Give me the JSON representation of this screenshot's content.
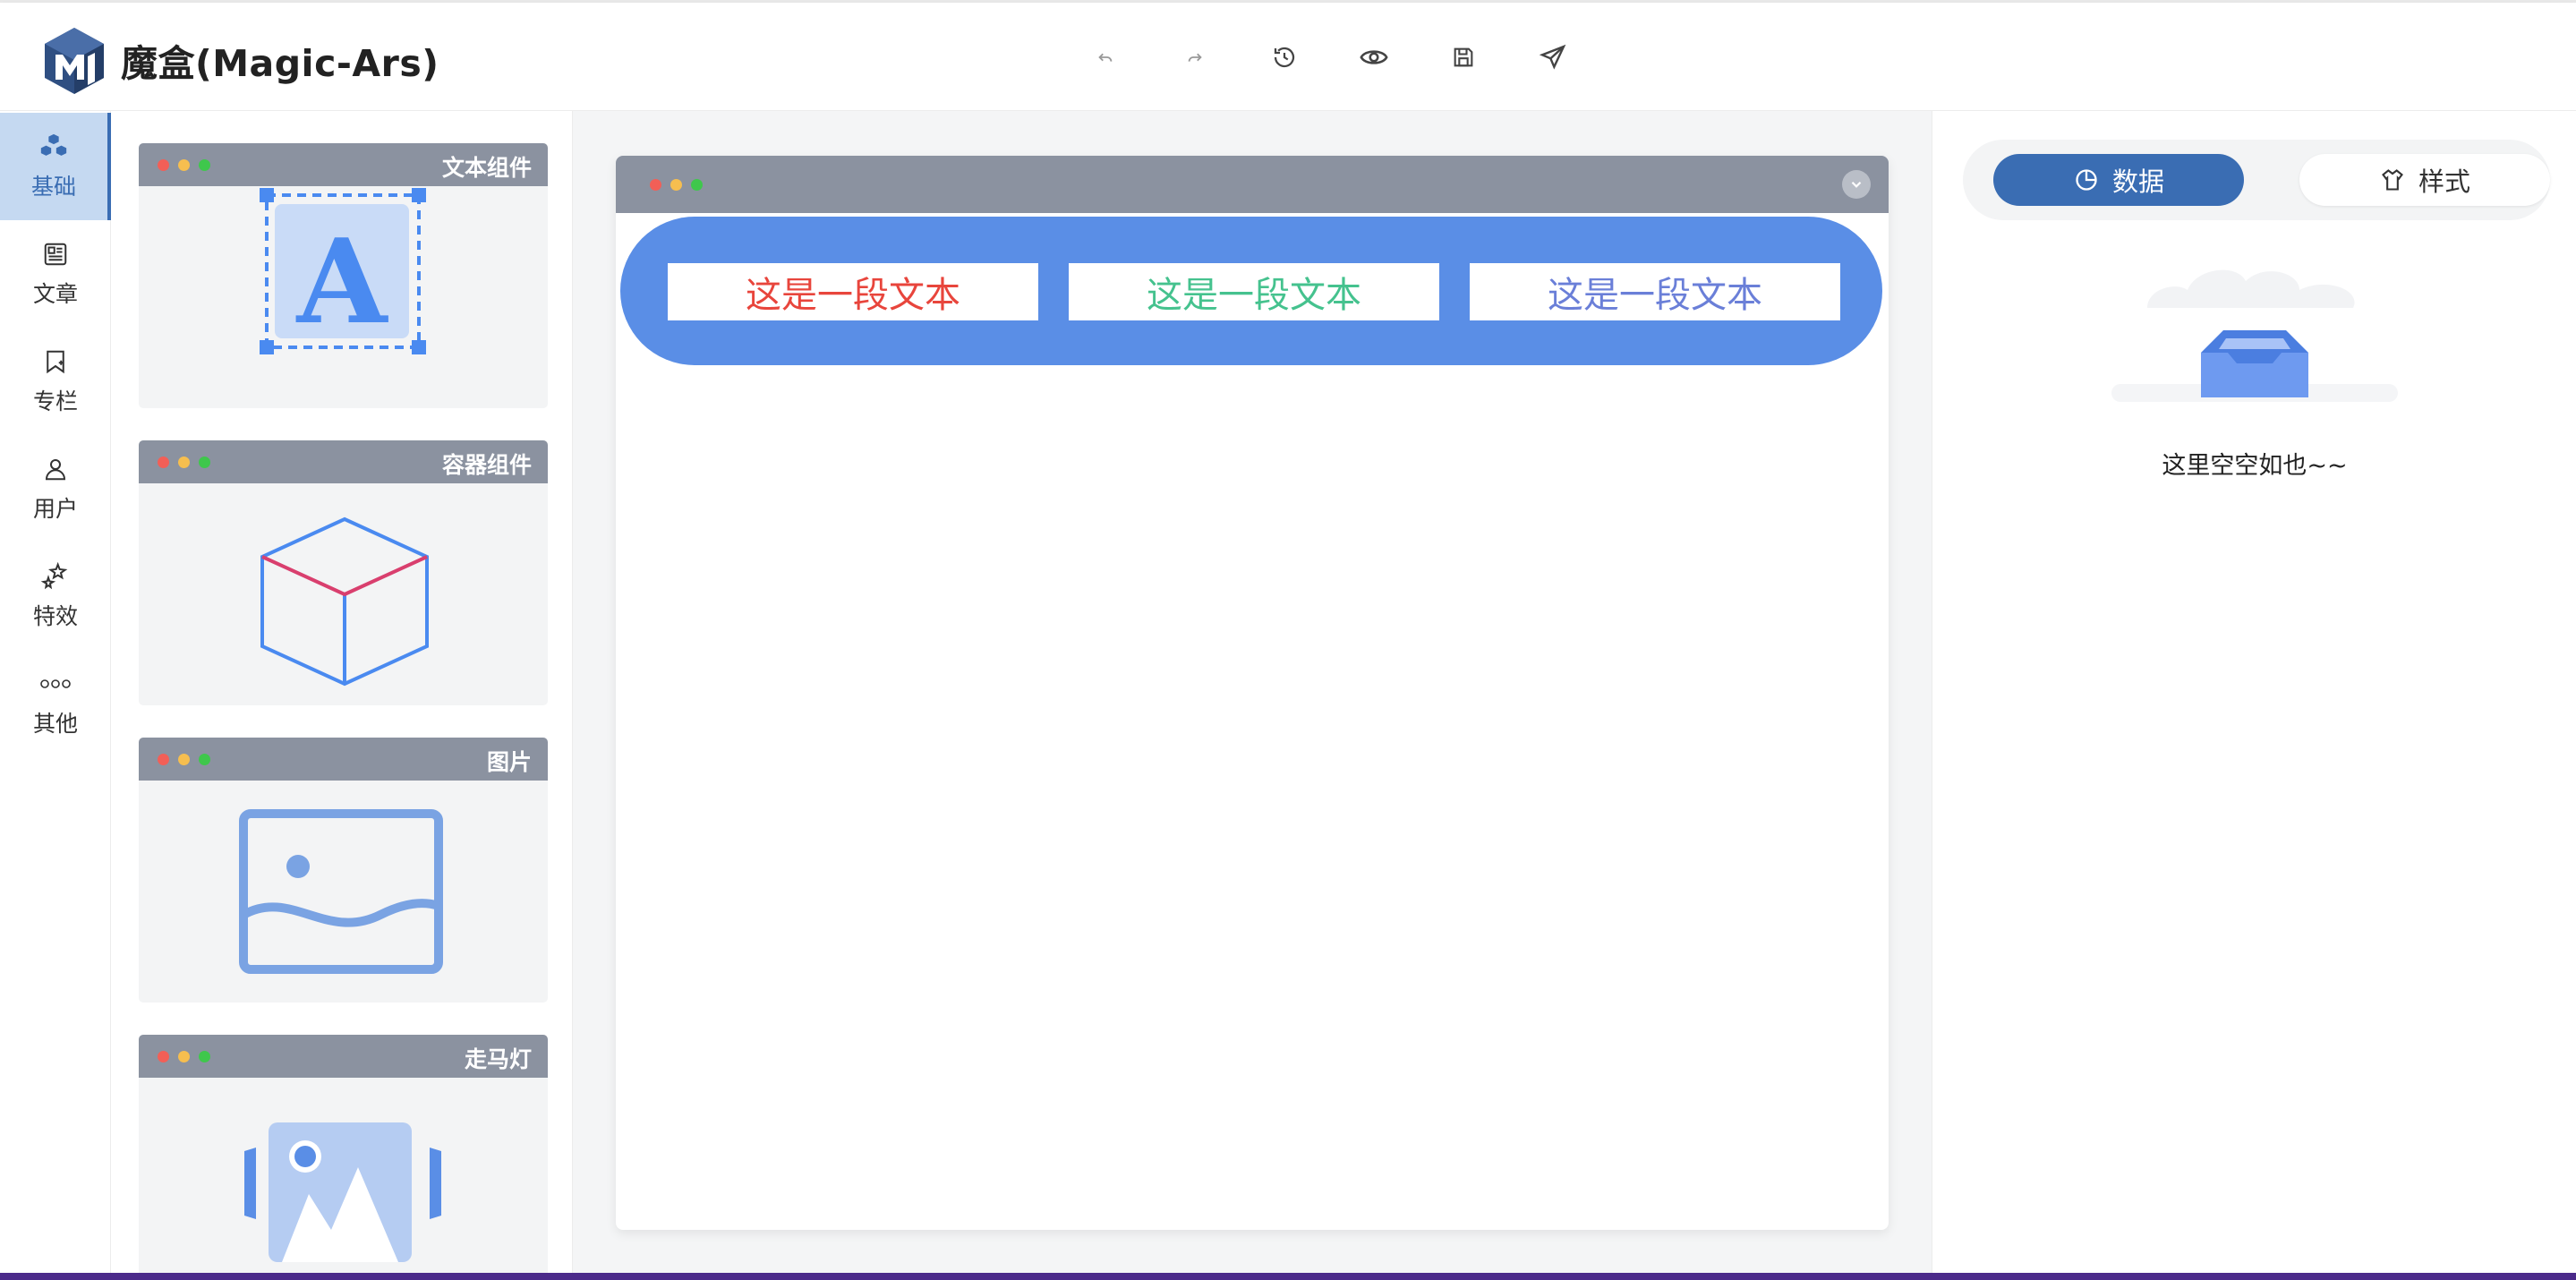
{
  "app": {
    "title": "魔盒(Magic-Ars)"
  },
  "toolbar": {
    "buttons": [
      {
        "name": "undo-button",
        "icon": "undo-icon"
      },
      {
        "name": "redo-button",
        "icon": "redo-icon"
      },
      {
        "name": "history-button",
        "icon": "history-icon"
      },
      {
        "name": "preview-button",
        "icon": "eye-icon"
      },
      {
        "name": "save-button",
        "icon": "save-icon"
      },
      {
        "name": "publish-button",
        "icon": "send-icon"
      }
    ]
  },
  "sidebar": {
    "items": [
      {
        "label": "基础",
        "icon": "cubes-icon",
        "active": true
      },
      {
        "label": "文章",
        "icon": "article-icon",
        "active": false
      },
      {
        "label": "专栏",
        "icon": "bookmark-icon",
        "active": false
      },
      {
        "label": "用户",
        "icon": "user-icon",
        "active": false
      },
      {
        "label": "特效",
        "icon": "sparkle-icon",
        "active": false
      },
      {
        "label": "其他",
        "icon": "more-icon",
        "active": false
      }
    ]
  },
  "components": [
    {
      "title": "文本组件",
      "icon": "text-component-icon"
    },
    {
      "title": "容器组件",
      "icon": "cube-icon"
    },
    {
      "title": "图片",
      "icon": "image-icon"
    },
    {
      "title": "走马灯",
      "icon": "carousel-icon"
    }
  ],
  "canvas": {
    "texts": [
      {
        "label": "这是一段文本",
        "color": "#e8453c"
      },
      {
        "label": "这是一段文本",
        "color": "#45c28e"
      },
      {
        "label": "这是一段文本",
        "color": "#6a7fd8"
      }
    ],
    "container_color": "#5a8ee6"
  },
  "properties": {
    "tabs": [
      {
        "label": "数据",
        "icon": "pie-chart-icon",
        "active": true
      },
      {
        "label": "样式",
        "icon": "shirt-icon",
        "active": false
      }
    ],
    "empty_text": "这里空空如也~~"
  },
  "colors": {
    "accent": "#3a6db3",
    "nav_active_bg": "#c5d9f1",
    "window_bar": "#8b92a0"
  }
}
